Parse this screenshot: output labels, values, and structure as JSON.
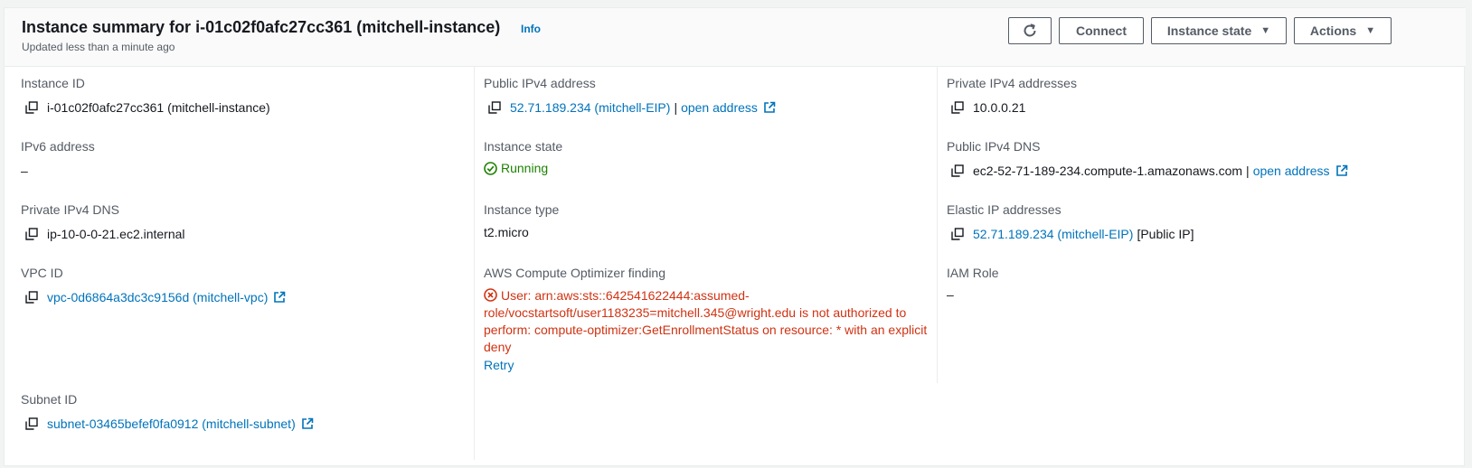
{
  "header": {
    "title": "Instance summary for i-01c02f0afc27cc361 (mitchell-instance)",
    "info": "Info",
    "updated": "Updated less than a minute ago",
    "buttons": {
      "refresh_icon": "refresh-icon",
      "connect": "Connect",
      "instance_state": "Instance state",
      "actions": "Actions"
    }
  },
  "col1": {
    "instance_id": {
      "label": "Instance ID",
      "value": "i-01c02f0afc27cc361 (mitchell-instance)"
    },
    "ipv6": {
      "label": "IPv6 address",
      "value": "–"
    },
    "private_dns": {
      "label": "Private IPv4 DNS",
      "value": "ip-10-0-0-21.ec2.internal"
    },
    "vpc": {
      "label": "VPC ID",
      "value": "vpc-0d6864a3dc3c9156d (mitchell-vpc)"
    },
    "subnet": {
      "label": "Subnet ID",
      "value": "subnet-03465befef0fa0912 (mitchell-subnet)"
    }
  },
  "col2": {
    "public_ip": {
      "label": "Public IPv4 address",
      "value": "52.71.189.234 (mitchell-EIP)",
      "sep": "|",
      "open": "open address"
    },
    "state": {
      "label": "Instance state",
      "value": "Running"
    },
    "type": {
      "label": "Instance type",
      "value": "t2.micro"
    },
    "optimizer": {
      "label": "AWS Compute Optimizer finding",
      "error": "User: arn:aws:sts::642541622444:assumed-role/vocstartsoft/user1183235=mitchell.345@wright.edu is not authorized to perform: compute-optimizer:GetEnrollmentStatus on resource: * with an explicit deny",
      "retry": "Retry"
    }
  },
  "col3": {
    "private_ips": {
      "label": "Private IPv4 addresses",
      "value": "10.0.0.21"
    },
    "public_dns": {
      "label": "Public IPv4 DNS",
      "value": "ec2-52-71-189-234.compute-1.amazonaws.com",
      "sep": "|",
      "open": "open address"
    },
    "eip": {
      "label": "Elastic IP addresses",
      "value": "52.71.189.234 (mitchell-EIP)",
      "suffix": "[Public IP]"
    },
    "iam": {
      "label": "IAM Role",
      "value": "–"
    }
  },
  "colors": {
    "link": "#0073bb",
    "success": "#1d8102",
    "error": "#d13212",
    "label": "#545b64"
  }
}
